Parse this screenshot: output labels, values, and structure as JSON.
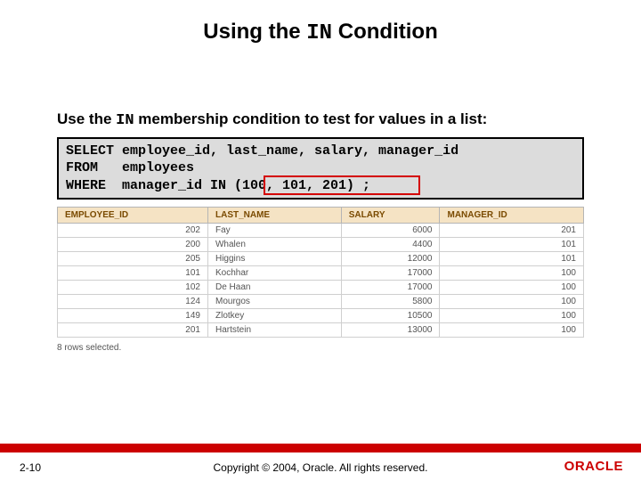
{
  "title": {
    "pre": "Using the ",
    "code": "IN",
    "post": " Condition"
  },
  "description": {
    "pre": "Use the ",
    "code": "IN",
    "post": " membership condition to test for values in a list:"
  },
  "sql": {
    "line1": "SELECT employee_id, last_name, salary, manager_id",
    "line2": "FROM   employees",
    "line3": "WHERE  manager_id IN (100, 101, 201) ;"
  },
  "table": {
    "headers": [
      "EMPLOYEE_ID",
      "LAST_NAME",
      "SALARY",
      "MANAGER_ID"
    ],
    "rows": [
      [
        "202",
        "Fay",
        "6000",
        "201"
      ],
      [
        "200",
        "Whalen",
        "4400",
        "101"
      ],
      [
        "205",
        "Higgins",
        "12000",
        "101"
      ],
      [
        "101",
        "Kochhar",
        "17000",
        "100"
      ],
      [
        "102",
        "De Haan",
        "17000",
        "100"
      ],
      [
        "124",
        "Mourgos",
        "5800",
        "100"
      ],
      [
        "149",
        "Zlotkey",
        "10500",
        "100"
      ],
      [
        "201",
        "Hartstein",
        "13000",
        "100"
      ]
    ],
    "rows_selected": "8 rows selected."
  },
  "footer": {
    "page": "2-10",
    "copyright": "Copyright © 2004, Oracle. All rights reserved.",
    "logo": "ORACLE"
  }
}
